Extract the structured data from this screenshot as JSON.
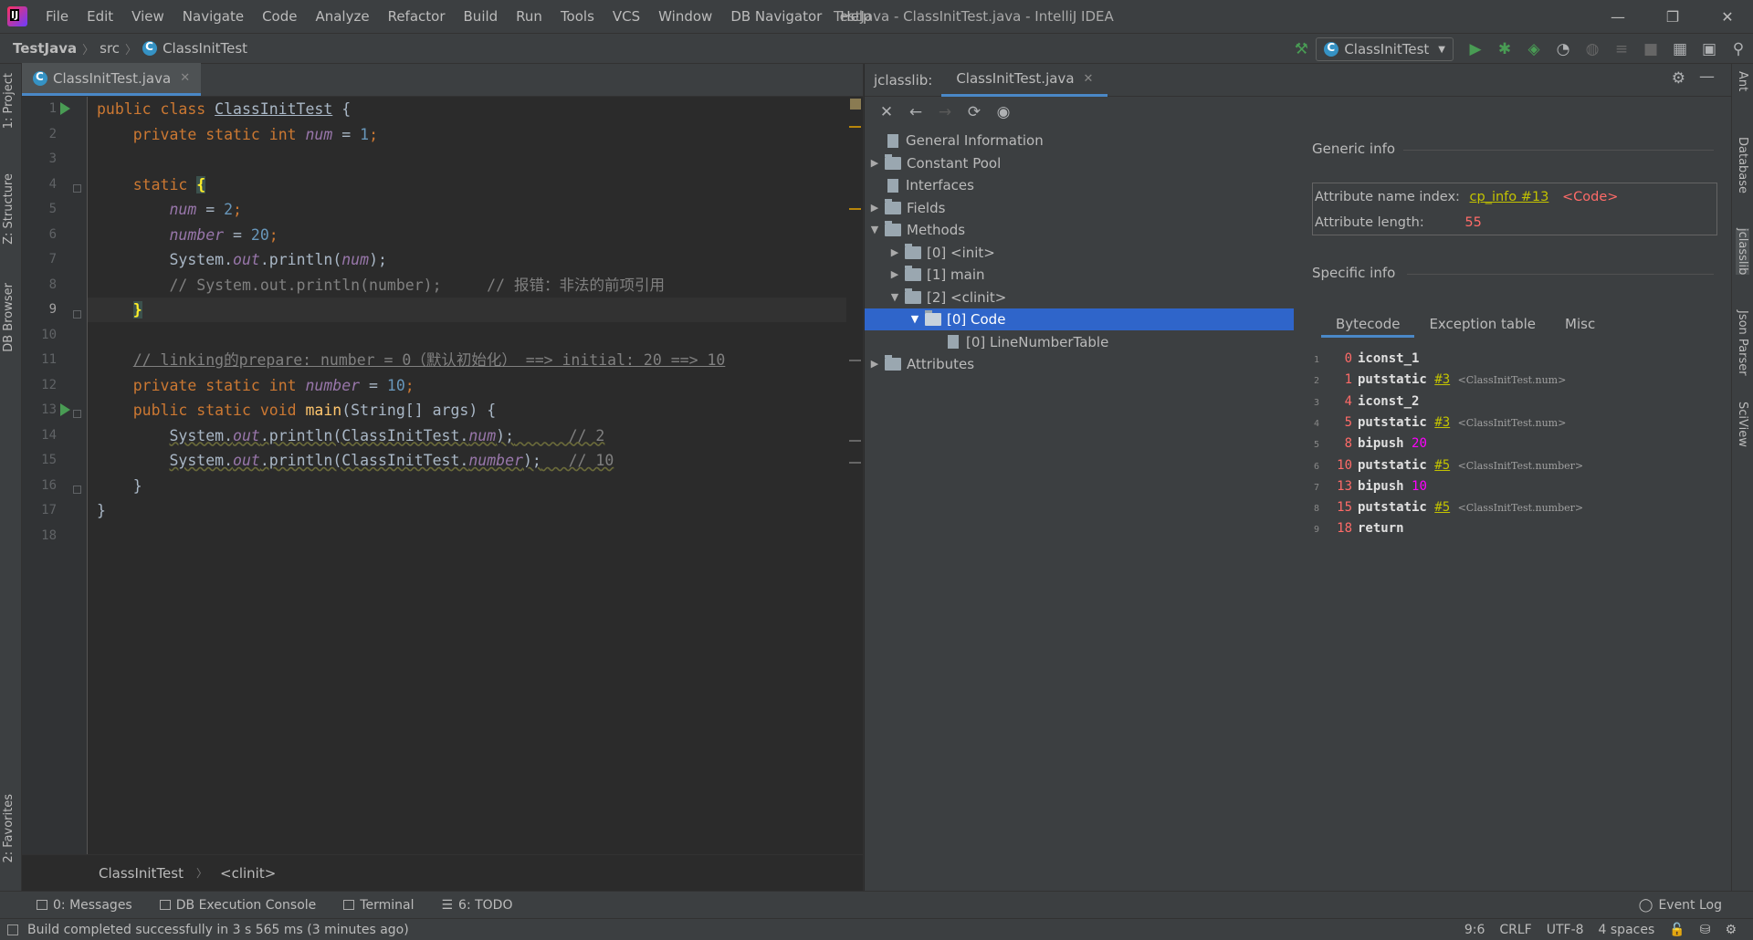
{
  "menubar": {
    "items": [
      "File",
      "Edit",
      "View",
      "Navigate",
      "Code",
      "Analyze",
      "Refactor",
      "Build",
      "Run",
      "Tools",
      "VCS",
      "Window",
      "DB Navigator",
      "Help"
    ],
    "window_title": "TestJava - ClassInitTest.java - IntelliJ IDEA"
  },
  "navbar": {
    "project": "TestJava",
    "folder": "src",
    "file": "ClassInitTest",
    "run_config": "ClassInitTest"
  },
  "left_stripe": {
    "project": "1: Project",
    "structure": "Z: Structure",
    "db_browser": "DB Browser",
    "favorites": "2: Favorites"
  },
  "right_stripe": {
    "ant": "Ant",
    "database": "Database",
    "jclasslib": "jclasslib",
    "json_parser": "Json Parser",
    "sciview": "SciView"
  },
  "editor": {
    "tab": "ClassInitTest.java",
    "line_numbers": [
      "1",
      "2",
      "3",
      "4",
      "5",
      "6",
      "7",
      "8",
      "9",
      "10",
      "11",
      "12",
      "13",
      "14",
      "15",
      "16",
      "17",
      "18"
    ],
    "breadcrumb": [
      "ClassInitTest",
      "<clinit>"
    ],
    "code": {
      "l1_kw": "public class ",
      "l1_cls": "ClassInitTest",
      "l1_rest": " {",
      "l2_kw": "private static int ",
      "l2_fld": "num",
      "l2_eq": " = ",
      "l2_num": "1",
      "l2_semi": ";",
      "l4_kw": "static ",
      "l4_brace": "{",
      "l5_fld": "num",
      "l5_eq": " = ",
      "l5_num": "2",
      "l5_semi": ";",
      "l6_fld": "number",
      "l6_eq": " = ",
      "l6_num": "20",
      "l6_semi": ";",
      "l7_a": "System.",
      "l7_out": "out",
      "l7_b": ".println(",
      "l7_fld": "num",
      "l7_c": ");",
      "l8_cmt": "// System.out.println(number);     // 报错：非法的前项引用",
      "l9_brace": "}",
      "l11_cmt": "// linking的prepare: number = 0（默认初始化） ==> initial: 20 ==> 10",
      "l12_kw": "private static int ",
      "l12_fld": "number",
      "l12_eq": " = ",
      "l12_num": "10",
      "l12_semi": ";",
      "l13_kw": "public static void ",
      "l13_mth": "main",
      "l13_rest": "(String[] args) {",
      "l14_a": "System.",
      "l14_out": "out",
      "l14_b": ".println(ClassInitTest.",
      "l14_fld": "num",
      "l14_c": ");",
      "l14_cmt": "      // 2",
      "l15_a": "System.",
      "l15_out": "out",
      "l15_b": ".println(ClassInitTest.",
      "l15_fld": "number",
      "l15_c": ");",
      "l15_cmt": "   // 10",
      "l16": "}",
      "l17": "}"
    }
  },
  "jclasslib": {
    "label": "jclasslib:",
    "tab": "ClassInitTest.java",
    "tree": {
      "general": "General Information",
      "constant_pool": "Constant Pool",
      "interfaces": "Interfaces",
      "fields": "Fields",
      "methods": "Methods",
      "m0": "[0] <init>",
      "m1": "[1] main",
      "m2": "[2] <clinit>",
      "code": "[0] Code",
      "lnt": "[0] LineNumberTable",
      "attributes": "Attributes"
    },
    "generic_info": "Generic info",
    "attr_name_label": "Attribute name index:",
    "attr_name_link": "cp_info #13",
    "attr_name_val": "<Code>",
    "attr_len_label": "Attribute length:",
    "attr_len_val": "55",
    "specific_info": "Specific info",
    "bytecode_tabs": [
      "Bytecode",
      "Exception table",
      "Misc"
    ],
    "bytecode": [
      {
        "n": "1",
        "off": "0",
        "op": "iconst_1",
        "ref": "",
        "arg": "",
        "cmt": ""
      },
      {
        "n": "2",
        "off": "1",
        "op": "putstatic",
        "ref": "#3",
        "arg": "",
        "cmt": "<ClassInitTest.num>"
      },
      {
        "n": "3",
        "off": "4",
        "op": "iconst_2",
        "ref": "",
        "arg": "",
        "cmt": ""
      },
      {
        "n": "4",
        "off": "5",
        "op": "putstatic",
        "ref": "#3",
        "arg": "",
        "cmt": "<ClassInitTest.num>"
      },
      {
        "n": "5",
        "off": "8",
        "op": "bipush",
        "ref": "",
        "arg": "20",
        "cmt": ""
      },
      {
        "n": "6",
        "off": "10",
        "op": "putstatic",
        "ref": "#5",
        "arg": "",
        "cmt": "<ClassInitTest.number>"
      },
      {
        "n": "7",
        "off": "13",
        "op": "bipush",
        "ref": "",
        "arg": "10",
        "cmt": ""
      },
      {
        "n": "8",
        "off": "15",
        "op": "putstatic",
        "ref": "#5",
        "arg": "",
        "cmt": "<ClassInitTest.number>"
      },
      {
        "n": "9",
        "off": "18",
        "op": "return",
        "ref": "",
        "arg": "",
        "cmt": ""
      }
    ]
  },
  "bottom_bar": {
    "messages": "0: Messages",
    "db_console": "DB Execution Console",
    "terminal": "Terminal",
    "todo": "6: TODO",
    "event_log": "Event Log"
  },
  "status": {
    "message": "Build completed successfully in 3 s 565 ms (3 minutes ago)",
    "position": "9:6",
    "line_sep": "CRLF",
    "encoding": "UTF-8",
    "indent": "4 spaces"
  }
}
